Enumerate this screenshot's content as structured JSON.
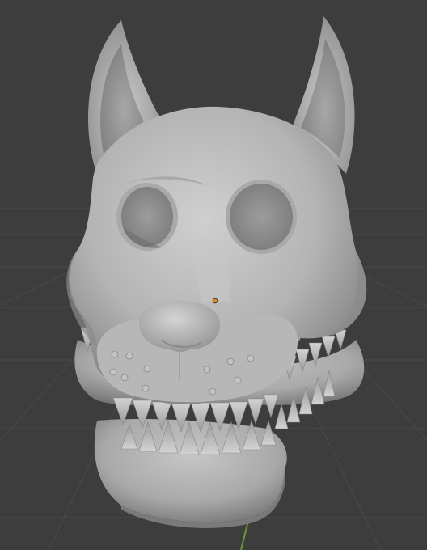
{
  "viewport": {
    "mode": "3d-viewport",
    "background_color": "#3d3d3d",
    "grid_color": "#4a4a4a",
    "mesh_color": "#b9b9b9",
    "mesh_shadow_color": "#6e6e6e",
    "origin_marker_color": "#e8891c",
    "y_axis_color": "#6b9a33"
  },
  "model": {
    "subject": "wolf-head-mask",
    "elements": [
      "ear-left",
      "ear-right",
      "eye-hole-left",
      "eye-hole-right",
      "nose",
      "whisker-dots",
      "upper-teeth",
      "lower-teeth",
      "lower-jaw"
    ]
  }
}
